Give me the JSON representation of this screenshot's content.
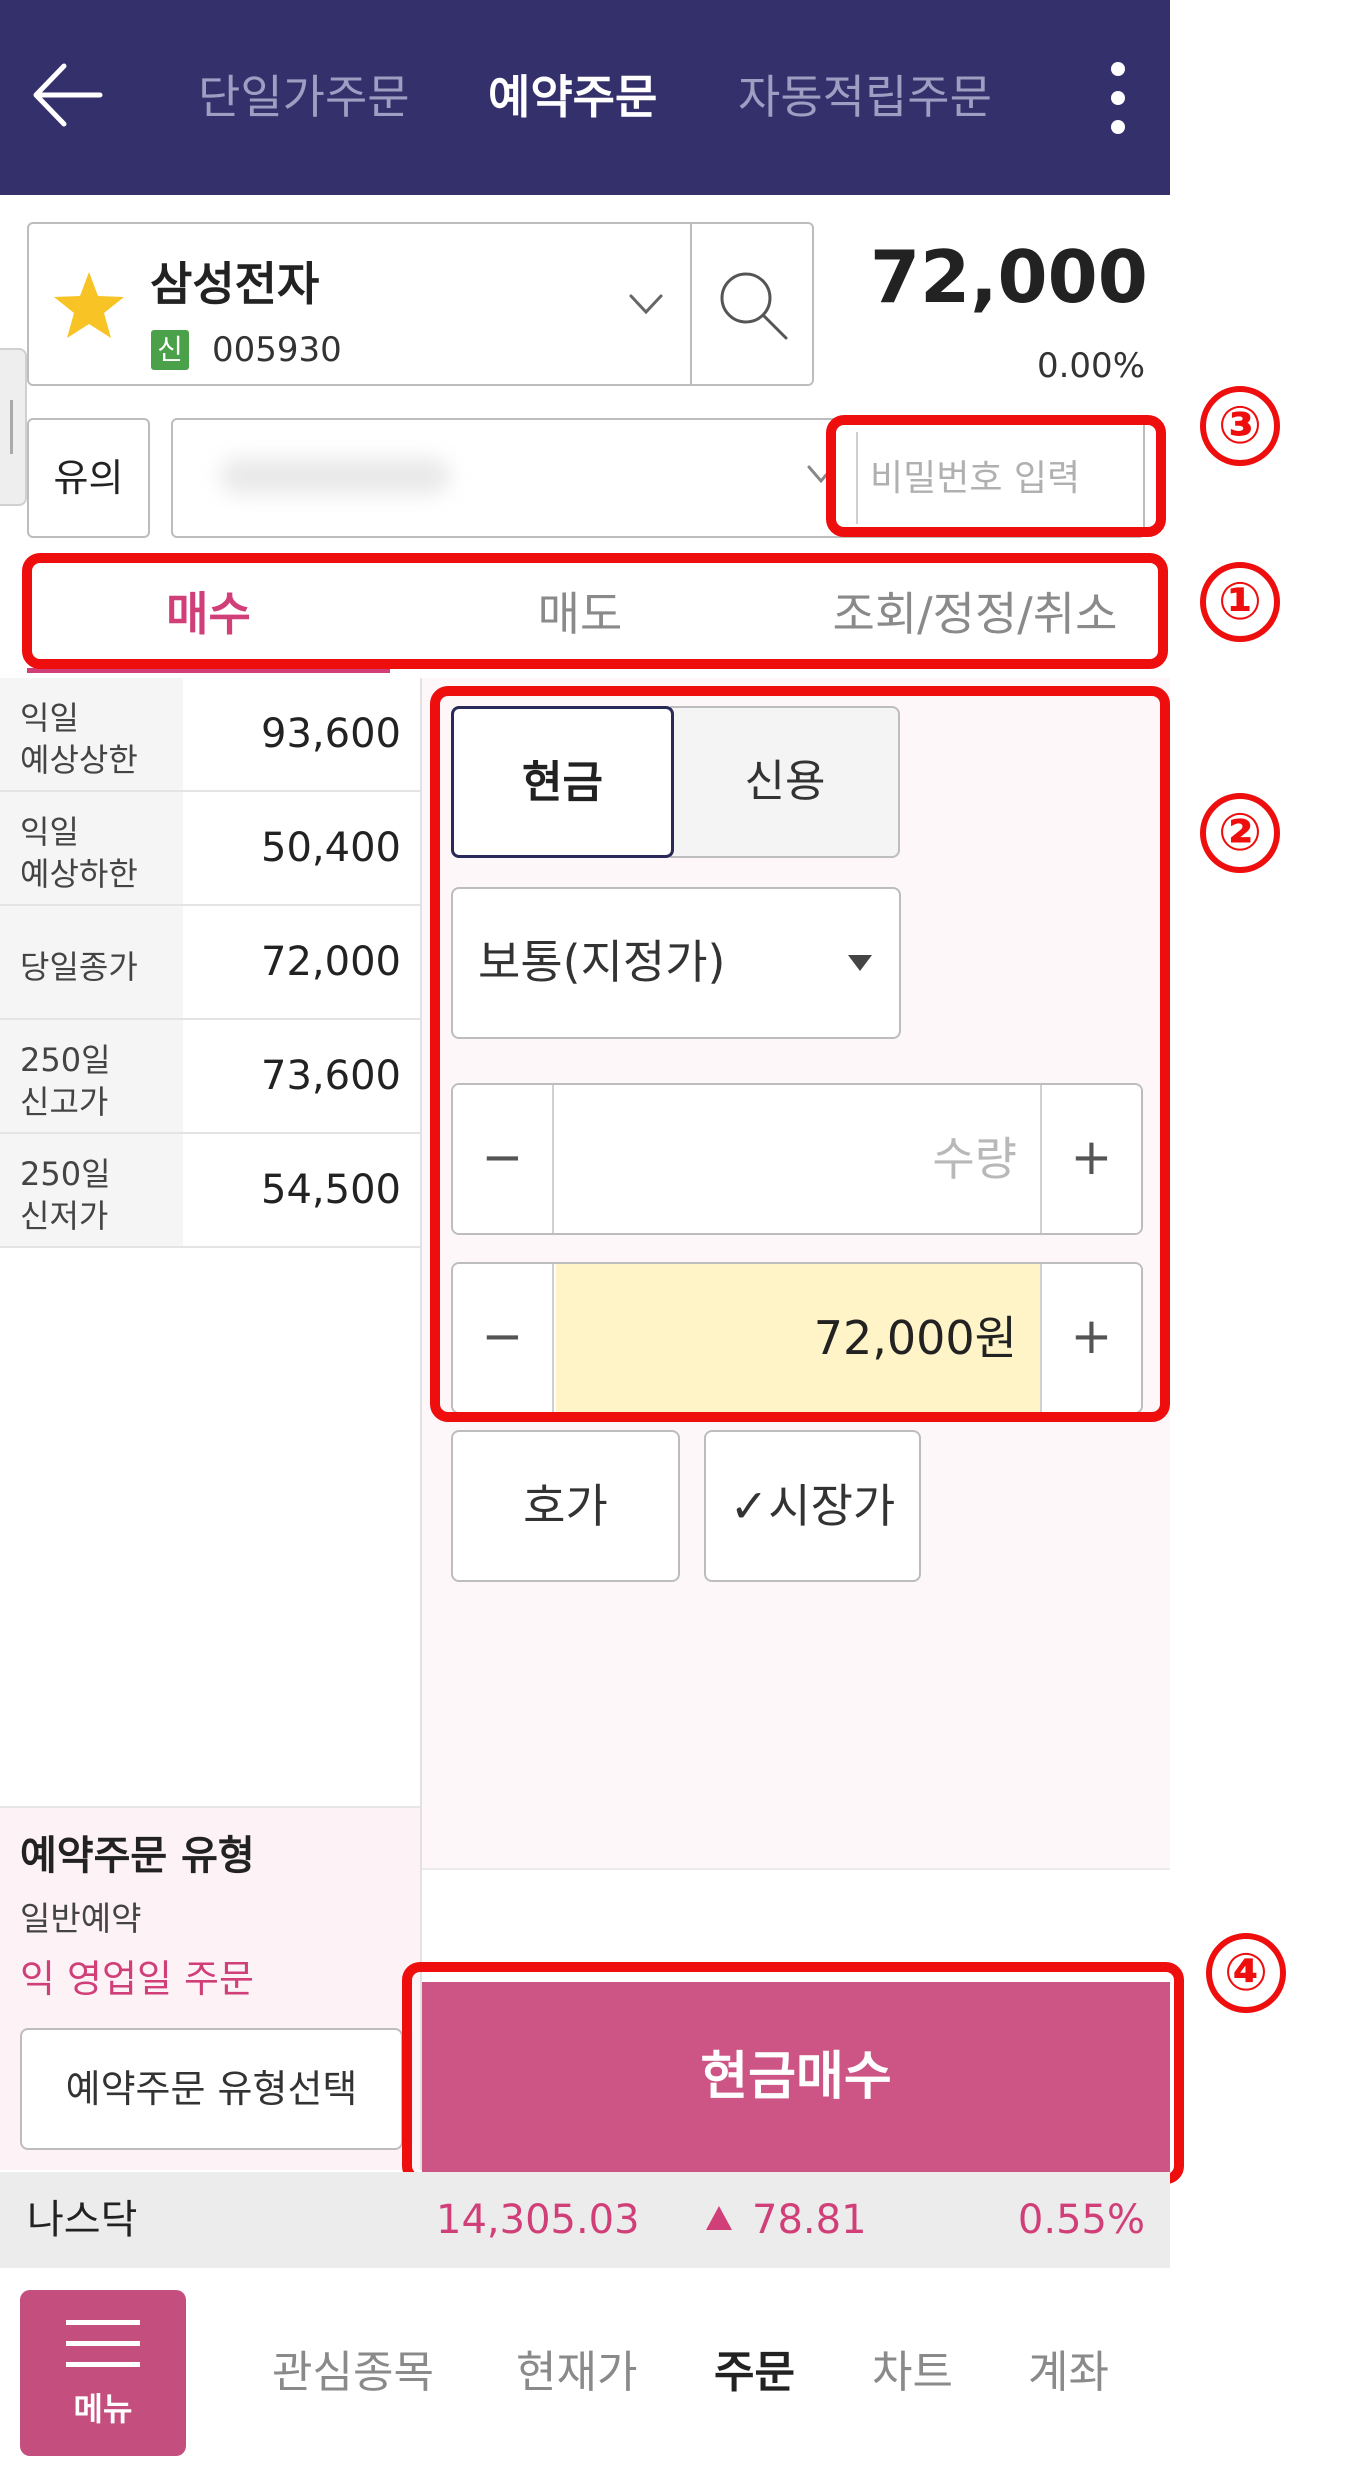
{
  "header": {
    "tabs": [
      {
        "label": "단일가주문",
        "active": false
      },
      {
        "label": "예약주문",
        "active": true
      },
      {
        "label": "자동적립주문",
        "active": false
      }
    ]
  },
  "stock": {
    "name": "삼성전자",
    "badge": "신",
    "code": "005930",
    "price": "72,000",
    "change_rate": "0.00%"
  },
  "account": {
    "notice_label": "유의",
    "password_placeholder": "비밀번호 입력"
  },
  "order_tabs": [
    {
      "label": "매수",
      "active": true
    },
    {
      "label": "매도",
      "active": false
    },
    {
      "label": "조회/정정/취소",
      "active": false
    }
  ],
  "info_table": [
    {
      "label": "익일\n예상상한",
      "value": "93,600"
    },
    {
      "label": "익일\n예상하한",
      "value": "50,400"
    },
    {
      "label": "당일종가",
      "value": "72,000"
    },
    {
      "label": "250일\n신고가",
      "value": "73,600"
    },
    {
      "label": "250일\n신저가",
      "value": "54,500"
    }
  ],
  "order_form": {
    "cash_label": "현금",
    "credit_label": "신용",
    "order_type": "보통(지정가)",
    "quantity_placeholder": "수량",
    "price_value": "72,000원",
    "minus": "−",
    "plus": "+",
    "quote_button": "호가",
    "market_price_button": "✓시장가"
  },
  "reserve": {
    "title": "예약주문 유형",
    "general": "일반예약",
    "next_day": "익 영업일 주문",
    "select_button": "예약주문 유형선택"
  },
  "submit_label": "현금매수",
  "annotations": [
    "①",
    "②",
    "③",
    "④"
  ],
  "ticker": {
    "name": "나스닥",
    "value": "14,305.03",
    "change": "78.81",
    "rate": "0.55%"
  },
  "bottom_nav": {
    "menu_label": "메뉴",
    "tabs": [
      {
        "label": "관심종목",
        "active": false
      },
      {
        "label": "현재가",
        "active": false
      },
      {
        "label": "주문",
        "active": true
      },
      {
        "label": "차트",
        "active": false
      },
      {
        "label": "계좌",
        "active": false
      }
    ]
  },
  "colors": {
    "header_bg": "#33306b",
    "accent_pink": "#d13f78",
    "submit_bg": "#cd5585",
    "highlight_red": "#ee0e0e",
    "price_field_bg": "#fff4c8"
  },
  "icons": {
    "back": "back-arrow-icon",
    "more": "kebab-menu-icon",
    "favorite": "star-icon",
    "search": "search-icon",
    "dropdown": "chevron-down-icon",
    "menu": "hamburger-icon",
    "up": "triangle-up-icon"
  }
}
